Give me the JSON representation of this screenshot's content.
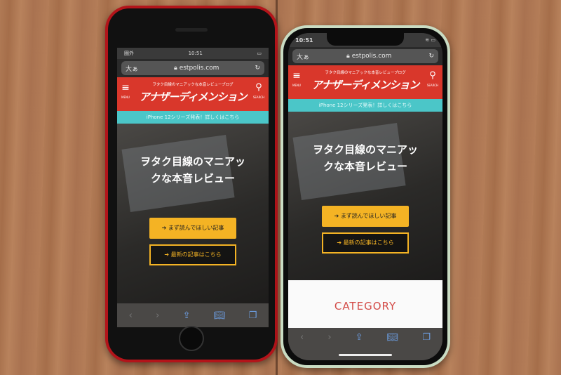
{
  "phones": [
    {
      "model_desc": "red",
      "status": {
        "carrier": "圏外",
        "time": "10:51"
      },
      "urlbar": {
        "text_size": "大ぁ",
        "url": "estpolis.com"
      },
      "site": {
        "tagline": "ヲタク目線のマニアックな本音レビューブログ",
        "logo": "アナザーディメンション",
        "menu": "MENU",
        "search": "SEARCH",
        "banner": "iPhone 12シリーズ発表！詳しくはこちら",
        "hero": "ヲタク目線のマニアックな本音レビュー",
        "button1": "まず読んでほしい記事",
        "button2": "最新の記事はこちら"
      }
    },
    {
      "model_desc": "green",
      "status": {
        "time": "10:51"
      },
      "urlbar": {
        "text_size": "大ぁ",
        "url": "estpolis.com"
      },
      "site": {
        "tagline": "ヲタク目線のマニアックな本音レビューブログ",
        "logo": "アナザーディメンション",
        "menu": "MENU",
        "search": "SEARCH",
        "banner": "iPhone 12シリーズ発表！詳しくはこちら",
        "hero": "ヲタク目線のマニアックな本音レビュー",
        "button1": "まず読んでほしい記事",
        "button2": "最新の記事はこちら",
        "category": "CATEGORY"
      }
    }
  ]
}
